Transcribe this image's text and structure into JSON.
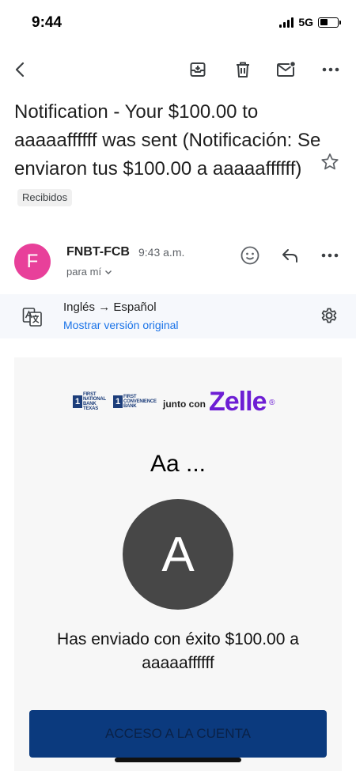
{
  "status_bar": {
    "time": "9:44",
    "network": "5G"
  },
  "toolbar": {
    "back": "back-arrow-icon",
    "archive": "archive-icon",
    "delete": "trash-icon",
    "mark_unread": "mail-unread-icon",
    "more": "more-horizontal-icon"
  },
  "email": {
    "subject": "Notification - Your  $100.00 to aaaaaffffff was sent (Notificación: Se enviaron tus $100.00 a aaaaaffffff)",
    "label": "Recibidos",
    "sender_initial": "F",
    "sender_name": "FNBT-FCB",
    "time": "9:43 a.m.",
    "recipient": "para mí",
    "avatar_color": "#e8409a"
  },
  "translation": {
    "languages": "Inglés → Español",
    "show_original": "Mostrar versión original"
  },
  "card": {
    "bank1_mark": "1",
    "bank1_text": "FIRST NATIONAL BANK TEXAS",
    "bank2_mark": "1",
    "bank2_text": "FIRST CONVENIENCE BANK",
    "junto": "junto con",
    "zelle": "Zelle",
    "zelle_reg": "®",
    "greeting": "Aa ...",
    "avatar_letter": "A",
    "message": "Has enviado con éxito $100.00 a aaaaaffffff",
    "cta": "ACCESO A LA CUENTA",
    "zelle_color": "#6d1ed4",
    "cta_color": "#0b3a7e"
  }
}
